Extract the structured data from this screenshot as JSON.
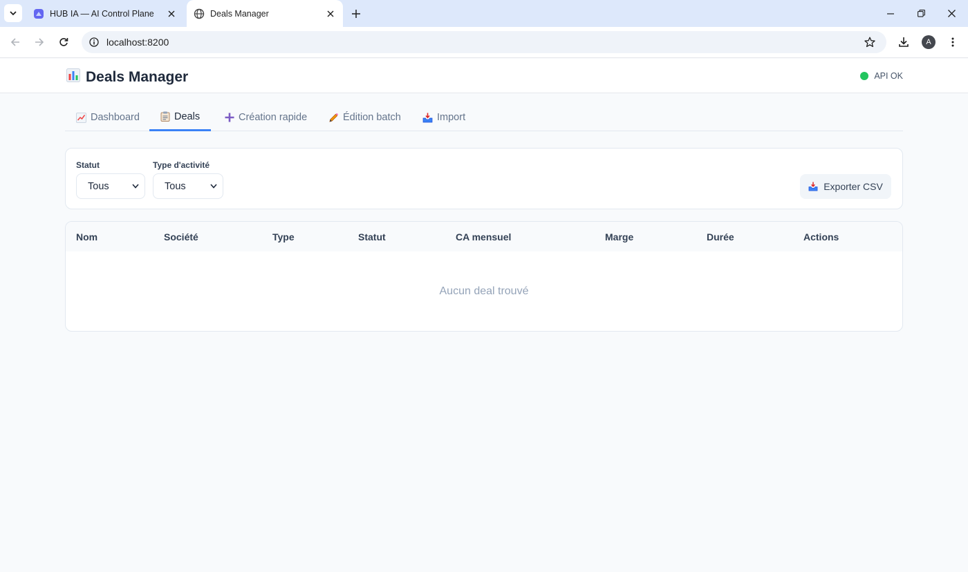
{
  "browser": {
    "tabs": [
      {
        "title": "HUB IA — AI Control Plane",
        "favicon": "hub-logo-icon"
      },
      {
        "title": "Deals Manager",
        "favicon": "globe-icon"
      }
    ],
    "url": "localhost:8200",
    "profile_initial": "A"
  },
  "app": {
    "title": "Deals Manager",
    "title_icon": "bar-chart-icon",
    "api_status": "API OK",
    "api_status_color": "#22c55e",
    "accent_color": "#3b82f6"
  },
  "nav": {
    "tabs": [
      {
        "label": "Dashboard",
        "icon": "chart-up-icon"
      },
      {
        "label": "Deals",
        "icon": "clipboard-icon",
        "active": true
      },
      {
        "label": "Création rapide",
        "icon": "plus-icon"
      },
      {
        "label": "Édition batch",
        "icon": "pencil-icon"
      },
      {
        "label": "Import",
        "icon": "inbox-tray-icon"
      }
    ]
  },
  "filters": {
    "status_label": "Statut",
    "status_value": "Tous",
    "activity_label": "Type d'activité",
    "activity_value": "Tous",
    "export_label": "Exporter CSV"
  },
  "table": {
    "columns": [
      "Nom",
      "Société",
      "Type",
      "Statut",
      "CA mensuel",
      "Marge",
      "Durée",
      "Actions"
    ],
    "rows": [],
    "empty_message": "Aucun deal trouvé"
  }
}
